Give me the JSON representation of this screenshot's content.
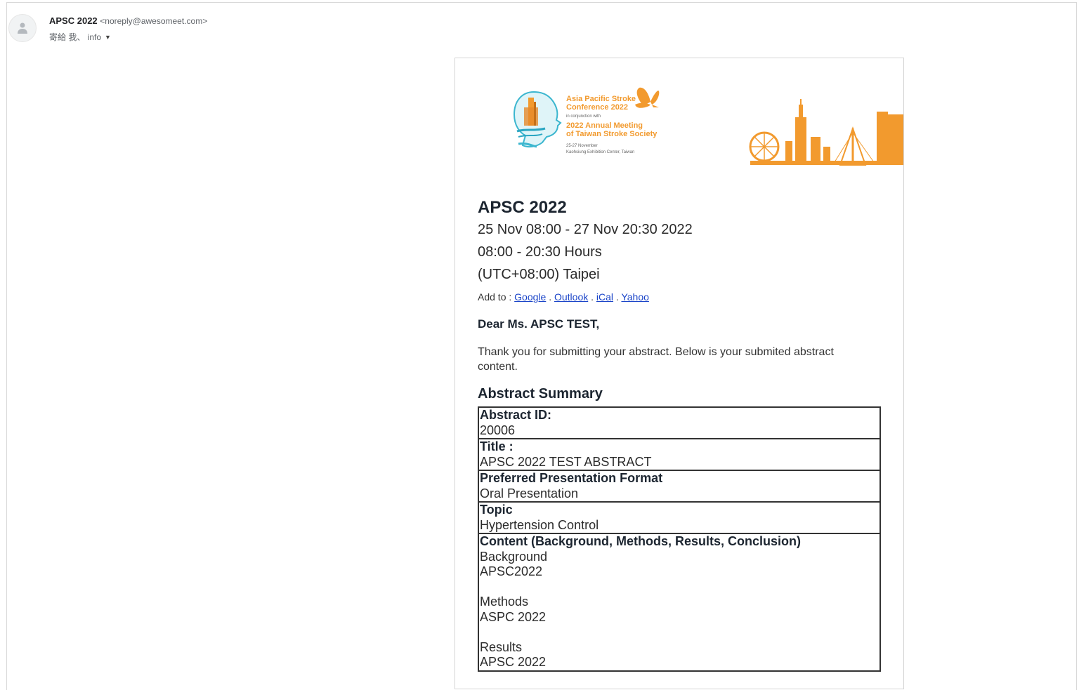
{
  "header": {
    "sender_name": "APSC 2022",
    "sender_email": "<noreply@awesomeet.com>",
    "recipients": "寄給 我、 info"
  },
  "banner": {
    "line1": "Asia Pacific Stroke",
    "line2": "Conference 2022",
    "line3": "in conjunction with",
    "line4": "2022 Annual Meeting",
    "line5": "of Taiwan Stroke Society",
    "line6": "25-27 November",
    "line7": "Kaohsiung Exhibition Center, Taiwan",
    "accent_color": "#f29a2e"
  },
  "event": {
    "title": "APSC 2022",
    "dates": "25 Nov 08:00 - 27 Nov 20:30 2022",
    "hours": "08:00 - 20:30 Hours",
    "timezone": "(UTC+08:00) Taipei",
    "add_to_label": "Add to :",
    "calendar_links": [
      "Google",
      "Outlook",
      "iCal",
      "Yahoo"
    ],
    "separator": "."
  },
  "message": {
    "greeting": "Dear Ms. APSC TEST,",
    "body": "Thank you for submitting your abstract. Below is your submited abstract content.",
    "summary_heading": "Abstract Summary"
  },
  "abstract": {
    "id_label": "Abstract ID:",
    "id_value": "20006",
    "title_label": "Title :",
    "title_value": "APSC 2022 TEST ABSTRACT",
    "format_label": "Preferred Presentation Format",
    "format_value": "Oral Presentation",
    "topic_label": "Topic",
    "topic_value": "Hypertension Control",
    "content_label": "Content (Background, Methods, Results, Conclusion)",
    "sections": [
      {
        "heading": "Background",
        "text": "APSC2022"
      },
      {
        "heading": "Methods",
        "text": "ASPC 2022"
      },
      {
        "heading": "Results",
        "text": "APSC 2022"
      }
    ]
  }
}
